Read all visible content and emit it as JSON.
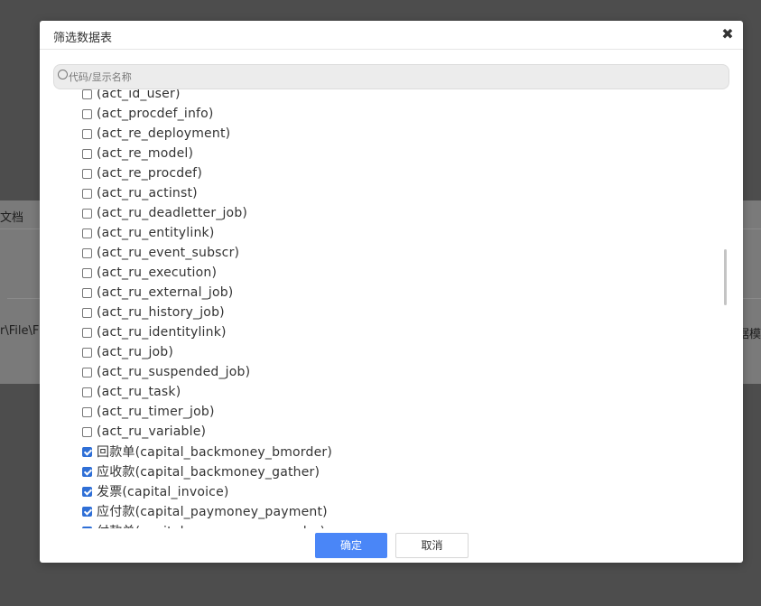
{
  "background": {
    "title_fragment": "文档",
    "path_fragment": "r\\File\\F",
    "right_fragment": "据模"
  },
  "dialog": {
    "title": "筛选数据表",
    "close_glyph": "✖",
    "search": {
      "placeholder": "代码/显示名称",
      "value": ""
    },
    "items": [
      {
        "label": "(act_id_user)",
        "checked": false
      },
      {
        "label": "(act_procdef_info)",
        "checked": false
      },
      {
        "label": "(act_re_deployment)",
        "checked": false
      },
      {
        "label": "(act_re_model)",
        "checked": false
      },
      {
        "label": "(act_re_procdef)",
        "checked": false
      },
      {
        "label": "(act_ru_actinst)",
        "checked": false
      },
      {
        "label": "(act_ru_deadletter_job)",
        "checked": false
      },
      {
        "label": "(act_ru_entitylink)",
        "checked": false
      },
      {
        "label": "(act_ru_event_subscr)",
        "checked": false
      },
      {
        "label": "(act_ru_execution)",
        "checked": false
      },
      {
        "label": "(act_ru_external_job)",
        "checked": false
      },
      {
        "label": "(act_ru_history_job)",
        "checked": false
      },
      {
        "label": "(act_ru_identitylink)",
        "checked": false
      },
      {
        "label": "(act_ru_job)",
        "checked": false
      },
      {
        "label": "(act_ru_suspended_job)",
        "checked": false
      },
      {
        "label": "(act_ru_task)",
        "checked": false
      },
      {
        "label": "(act_ru_timer_job)",
        "checked": false
      },
      {
        "label": "(act_ru_variable)",
        "checked": false
      },
      {
        "label": "回款单(capital_backmoney_bmorder)",
        "checked": true
      },
      {
        "label": "应收款(capital_backmoney_gather)",
        "checked": true
      },
      {
        "label": "发票(capital_invoice)",
        "checked": true
      },
      {
        "label": "应付款(capital_paymoney_payment)",
        "checked": true
      },
      {
        "label": "付款单(capital_paymoney_pmorder)",
        "checked": true
      }
    ],
    "confirm_label": "确定",
    "cancel_label": "取消"
  },
  "colors": {
    "overlay": "#4d4d4d",
    "primary_button": "#4a86f7",
    "checkbox_checked": "#2f6fd6"
  }
}
